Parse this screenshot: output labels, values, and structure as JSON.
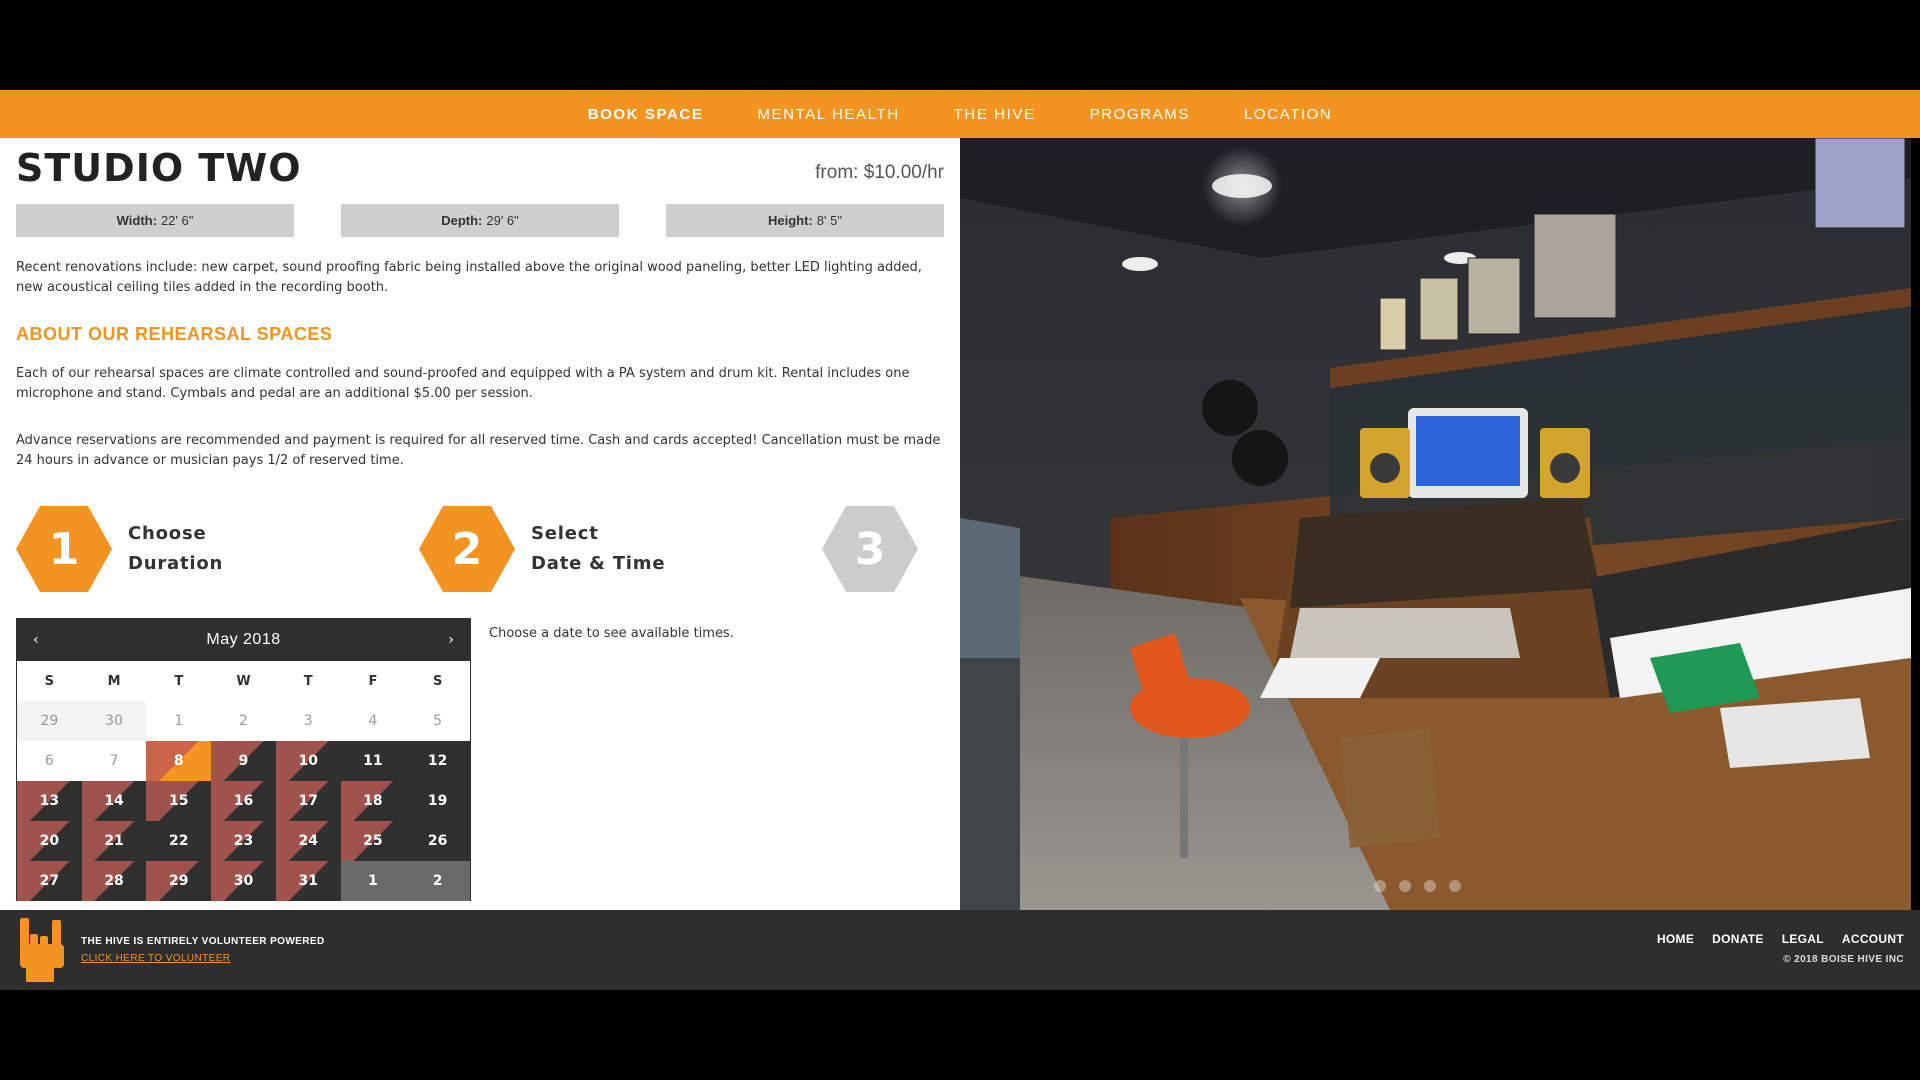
{
  "nav": {
    "items": [
      {
        "label": "BOOK SPACE",
        "active": true
      },
      {
        "label": "MENTAL HEALTH",
        "active": false
      },
      {
        "label": "THE HIVE",
        "active": false
      },
      {
        "label": "PROGRAMS",
        "active": false
      },
      {
        "label": "LOCATION",
        "active": false
      }
    ]
  },
  "studio": {
    "title": "STUDIO TWO",
    "price": "from: $10.00/hr",
    "dims": [
      {
        "label": "Width:",
        "value": "22' 6\""
      },
      {
        "label": "Depth:",
        "value": "29' 6\""
      },
      {
        "label": "Height:",
        "value": "8' 5\""
      }
    ],
    "renovations": "Recent renovations include: new carpet, sound proofing fabric being installed above the original wood paneling, better LED lighting added, new acoustical ceiling tiles added in the recording booth.",
    "about_heading": "ABOUT OUR REHEARSAL SPACES",
    "about_p1": "Each of our rehearsal spaces are climate controlled and sound-proofed and equipped with a PA system and drum kit. Rental includes one microphone and stand. Cymbals and pedal are an additional $5.00 per session.",
    "about_p2": "Advance reservations are recommended and payment is required for all reserved time. Cash and cards accepted! Cancellation must be made 24 hours in advance or musician pays 1/2 of reserved time."
  },
  "steps": [
    {
      "number": "1",
      "line1": "Choose",
      "line2": "Duration"
    },
    {
      "number": "2",
      "line1": "Select",
      "line2": "Date & Time"
    },
    {
      "number": "3",
      "line1": "",
      "line2": ""
    }
  ],
  "calendar": {
    "month_label": "May 2018",
    "prev_arrow": "‹",
    "next_arrow": "›",
    "dow": [
      "S",
      "M",
      "T",
      "W",
      "T",
      "F",
      "S"
    ],
    "days": [
      {
        "d": "29",
        "s": "past-prev"
      },
      {
        "d": "30",
        "s": "past-prev"
      },
      {
        "d": "1",
        "s": "past"
      },
      {
        "d": "2",
        "s": "past"
      },
      {
        "d": "3",
        "s": "past"
      },
      {
        "d": "4",
        "s": "past"
      },
      {
        "d": "5",
        "s": "past"
      },
      {
        "d": "6",
        "s": "past"
      },
      {
        "d": "7",
        "s": "past"
      },
      {
        "d": "8",
        "s": "today"
      },
      {
        "d": "9",
        "s": "partial"
      },
      {
        "d": "10",
        "s": "partial"
      },
      {
        "d": "11",
        "s": "avail"
      },
      {
        "d": "12",
        "s": "avail"
      },
      {
        "d": "13",
        "s": "partial"
      },
      {
        "d": "14",
        "s": "partial"
      },
      {
        "d": "15",
        "s": "partial"
      },
      {
        "d": "16",
        "s": "partial"
      },
      {
        "d": "17",
        "s": "partial"
      },
      {
        "d": "18",
        "s": "partial"
      },
      {
        "d": "19",
        "s": "avail"
      },
      {
        "d": "20",
        "s": "partial"
      },
      {
        "d": "21",
        "s": "partial"
      },
      {
        "d": "22",
        "s": "avail"
      },
      {
        "d": "23",
        "s": "partial"
      },
      {
        "d": "24",
        "s": "partial"
      },
      {
        "d": "25",
        "s": "partial"
      },
      {
        "d": "26",
        "s": "avail"
      },
      {
        "d": "27",
        "s": "partial"
      },
      {
        "d": "28",
        "s": "partial"
      },
      {
        "d": "29",
        "s": "partial"
      },
      {
        "d": "30",
        "s": "partial"
      },
      {
        "d": "31",
        "s": "partial"
      },
      {
        "d": "1",
        "s": "next"
      },
      {
        "d": "2",
        "s": "next"
      }
    ]
  },
  "choose_msg": "Choose a date to see available times.",
  "footer": {
    "volunteer_text": "THE HIVE IS ENTIRELY VOLUNTEER POWERED",
    "volunteer_link": "CLICK HERE TO VOLUNTEER",
    "links": [
      "HOME",
      "DONATE",
      "LEGAL",
      "ACCOUNT"
    ],
    "copyright": "© 2018 BOISE HIVE INC"
  },
  "colors": {
    "brand_orange": "#f39321",
    "calendar_dark": "#303030",
    "partial_booked": "#a0524c",
    "footer_bg": "#2e2e2e"
  },
  "icons": {
    "footer_logo": "rock-hand-icon",
    "cal_prev": "chevron-left-icon",
    "cal_next": "chevron-right-icon"
  }
}
